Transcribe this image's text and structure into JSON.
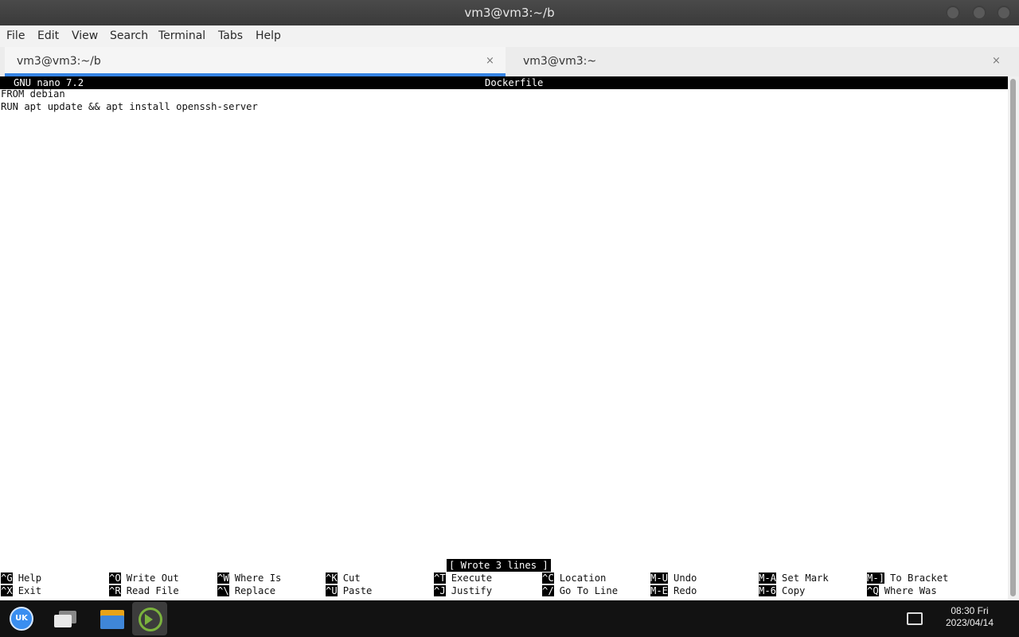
{
  "window": {
    "title": "vm3@vm3:~/b",
    "controls": [
      "minimize",
      "maximize",
      "close"
    ]
  },
  "menu": [
    "File",
    "Edit",
    "View",
    "Search",
    "Terminal",
    "Tabs",
    "Help"
  ],
  "tabs": [
    {
      "label": "vm3@vm3:~/b",
      "active": true,
      "close": "×"
    },
    {
      "label": "vm3@vm3:~",
      "active": false,
      "close": "×"
    }
  ],
  "nano": {
    "version": "GNU nano 7.2",
    "filename": "Dockerfile",
    "lines": [
      "FROM debian",
      "RUN apt update && apt install openssh-server"
    ],
    "status": "[ Wrote 3 lines ]",
    "shortcuts_row1": [
      {
        "key": "^G",
        "label": "Help"
      },
      {
        "key": "^O",
        "label": "Write Out"
      },
      {
        "key": "^W",
        "label": "Where Is"
      },
      {
        "key": "^K",
        "label": "Cut"
      },
      {
        "key": "^T",
        "label": "Execute"
      },
      {
        "key": "^C",
        "label": "Location"
      },
      {
        "key": "M-U",
        "label": "Undo"
      },
      {
        "key": "M-A",
        "label": "Set Mark"
      },
      {
        "key": "M-]",
        "label": "To Bracket"
      }
    ],
    "shortcuts_row2": [
      {
        "key": "^X",
        "label": "Exit"
      },
      {
        "key": "^R",
        "label": "Read File"
      },
      {
        "key": "^\\",
        "label": "Replace"
      },
      {
        "key": "^U",
        "label": "Paste"
      },
      {
        "key": "^J",
        "label": "Justify"
      },
      {
        "key": "^/",
        "label": "Go To Line"
      },
      {
        "key": "M-E",
        "label": "Redo"
      },
      {
        "key": "M-6",
        "label": "Copy"
      },
      {
        "key": "^Q",
        "label": "Where Was"
      }
    ]
  },
  "taskbar": {
    "launcher_label": "UK",
    "apps": [
      "launcher-icon",
      "windows-icon",
      "file-manager-icon",
      "terminal-icon"
    ],
    "clock_time": "08:30 Fri",
    "clock_date": "2023/04/14"
  }
}
